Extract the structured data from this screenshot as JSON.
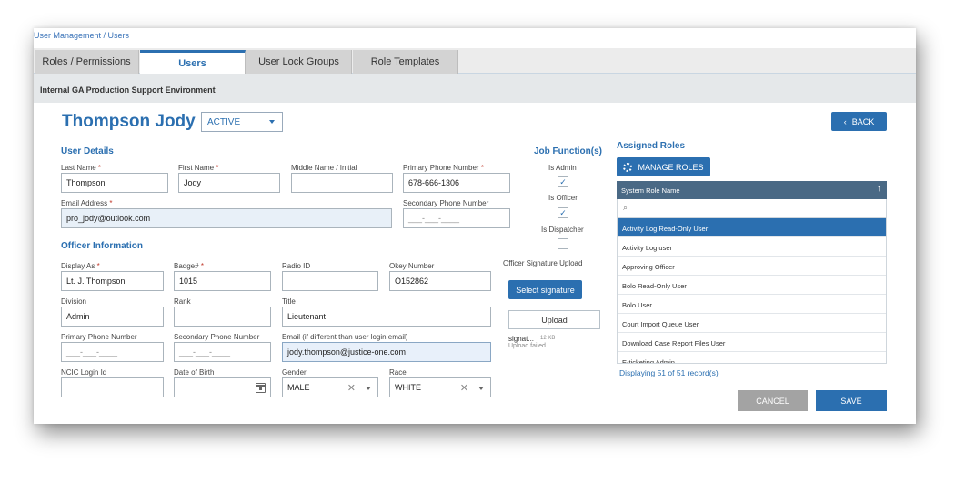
{
  "breadcrumb": "User Management / Users",
  "tabs": [
    "Roles / Permissions",
    "Users",
    "User Lock Groups",
    "Role Templates"
  ],
  "environment": "Internal GA Production Support Environment",
  "user": {
    "name": "Thompson Jody",
    "status": "ACTIVE"
  },
  "back_label": "BACK",
  "user_details": {
    "title": "User Details",
    "last_name_label": "Last Name",
    "last_name": "Thompson",
    "first_name_label": "First Name",
    "first_name": "Jody",
    "middle_name_label": "Middle Name / Initial",
    "middle_name": "",
    "primary_phone_label": "Primary Phone Number",
    "primary_phone": "678-666-1306",
    "email_label": "Email Address",
    "email": "pro_jody@outlook.com",
    "secondary_phone_label": "Secondary Phone Number",
    "secondary_phone_placeholder": "___-___-____"
  },
  "job_function": {
    "title": "Job Function(s)",
    "is_admin_label": "Is Admin",
    "is_admin": "✓",
    "is_officer_label": "Is Officer",
    "is_officer": "✓",
    "is_dispatcher_label": "Is Dispatcher",
    "is_dispatcher": ""
  },
  "officer": {
    "title": "Officer Information",
    "display_as_label": "Display As",
    "display_as": "Lt. J. Thompson",
    "badge_label": "Badge#",
    "badge": "1015",
    "radio_label": "Radio ID",
    "radio": "",
    "okey_label": "Okey Number",
    "okey": "O152862",
    "division_label": "Division",
    "division": "Admin",
    "rank_label": "Rank",
    "rank": "",
    "title_label": "Title",
    "title_value": "Lieutenant",
    "primary_phone_label": "Primary Phone Number",
    "primary_phone_placeholder": "___-___-____",
    "secondary_phone_label": "Secondary Phone Number",
    "secondary_phone_placeholder": "___-___-____",
    "email_label": "Email (if different than user login email)",
    "email": "jody.thompson@justice-one.com",
    "ncic_label": "NCIC Login Id",
    "ncic": "",
    "dob_label": "Date of Birth",
    "dob": "",
    "gender_label": "Gender",
    "gender": "MALE",
    "race_label": "Race",
    "race": "WHITE"
  },
  "signature": {
    "title": "Officer Signature Upload",
    "select_label": "Select signature",
    "upload_label": "Upload",
    "file_name": "signat...",
    "file_size": "12 KB",
    "status": "Upload failed"
  },
  "assigned_roles": {
    "title": "Assigned Roles",
    "manage_label": "MANAGE ROLES",
    "column": "System Role Name",
    "sort_icon": "↑",
    "search_icon": "⌕",
    "items": [
      "Activity Log Read-Only User",
      "Activity Log user",
      "Approving Officer",
      "Bolo Read-Only User",
      "Bolo User",
      "Court Import Queue User",
      "Download Case Report Files User",
      "E-ticketing Admin"
    ],
    "displaying": "Displaying 51 of 51 record(s)"
  },
  "actions": {
    "cancel": "CANCEL",
    "save": "SAVE"
  },
  "colors": {
    "primary": "#2b6fb0",
    "header_row": "#4a6985",
    "cancel": "#a3a3a3"
  }
}
